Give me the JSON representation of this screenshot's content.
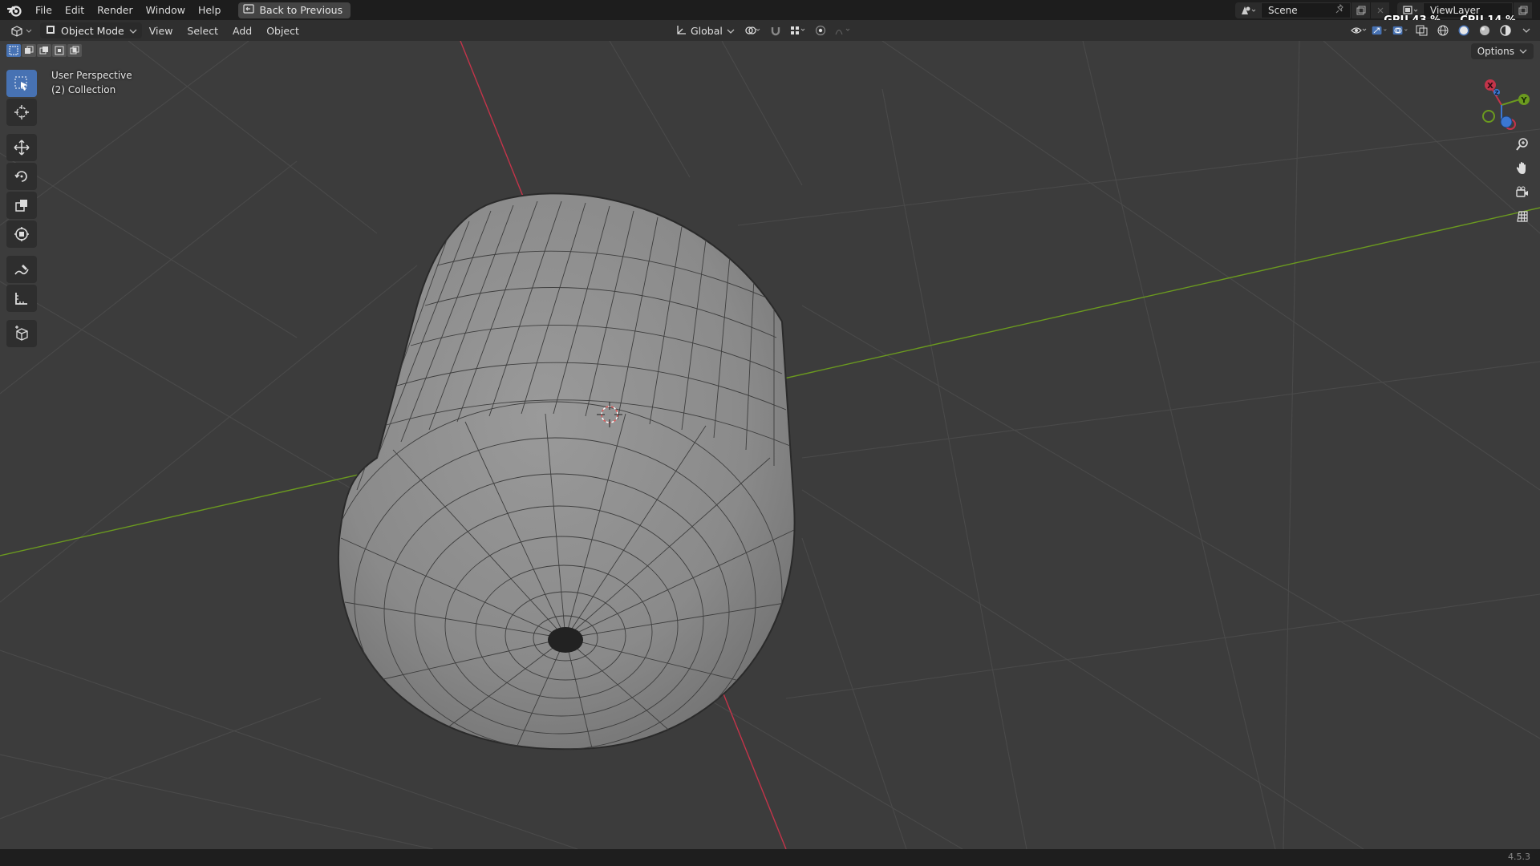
{
  "menubar": {
    "items": [
      "File",
      "Edit",
      "Render",
      "Window",
      "Help"
    ],
    "back_button": "Back to Previous"
  },
  "top_right": {
    "scene": "Scene",
    "view_layer": "ViewLayer",
    "gpu_label": "GPU 43 %",
    "cpu_label": "CPU 14 %"
  },
  "header": {
    "mode": "Object Mode",
    "menus": [
      "View",
      "Select",
      "Add",
      "Object"
    ],
    "orientation": "Global"
  },
  "viewport": {
    "perspective_label": "User Perspective",
    "collection_label": "(2) Collection",
    "options_label": "Options",
    "gizmo": {
      "x_label": "X",
      "y_label": "Y",
      "z_label": "Z"
    }
  },
  "toolbar_tools": [
    "select-box",
    "cursor",
    "move",
    "rotate",
    "scale",
    "transform",
    "annotate",
    "measure",
    "add-cube"
  ],
  "status": {
    "version": "4.5.3"
  },
  "colors": {
    "accent": "#4772b3",
    "x_axis": "#c4344a",
    "y_axis": "#6b9a1f",
    "z_axis": "#3b77d1",
    "viewport_bg": "#3c3c3c"
  }
}
